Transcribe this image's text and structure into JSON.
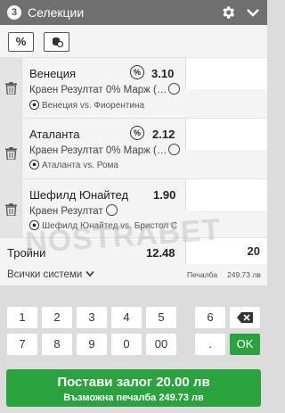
{
  "header": {
    "count": "3",
    "title": "Селекции",
    "icons": [
      "gear-icon",
      "chevron-down-icon"
    ]
  },
  "toolbar": {
    "percent_label": "%",
    "coins_icon": "coins-icon"
  },
  "bets": [
    {
      "team": "Венеция",
      "odds": "3.10",
      "market": "Краен Резултат 0% Марж (…",
      "match": "Венеция vs. Фиорентина",
      "has_percent_badge": true
    },
    {
      "team": "Аталанта",
      "odds": "2.12",
      "market": "Краен Резултат 0% Марж (…",
      "match": "Аталанта vs. Рома",
      "has_percent_badge": true
    },
    {
      "team": "Шефилд Юнайтед",
      "odds": "1.90",
      "market": "Краен Резултат",
      "match": "Шефилд Юнайтед vs. Бристол С",
      "has_percent_badge": false
    }
  ],
  "triple": {
    "label": "Тройни",
    "odds": "12.48",
    "stake": "20"
  },
  "systems": {
    "all_label": "Всички системи",
    "win_label": "Печалба",
    "win_value": "249.73 лв"
  },
  "keypad": {
    "row1": [
      "1",
      "2",
      "3",
      "4",
      "5",
      "6"
    ],
    "row2": [
      "7",
      "8",
      "9",
      "0",
      "00",
      "."
    ],
    "ok_label": "OK"
  },
  "place_bet": {
    "main": "Постави залог 20.00 лв",
    "sub": "Възможна печалба 249.73 лв"
  },
  "watermark": "NOSTRABET",
  "colors": {
    "header": "#6f6f6f",
    "accent_green": "#2aa33e",
    "panel": "#f4f4f4",
    "background": "#dcdcdc"
  }
}
